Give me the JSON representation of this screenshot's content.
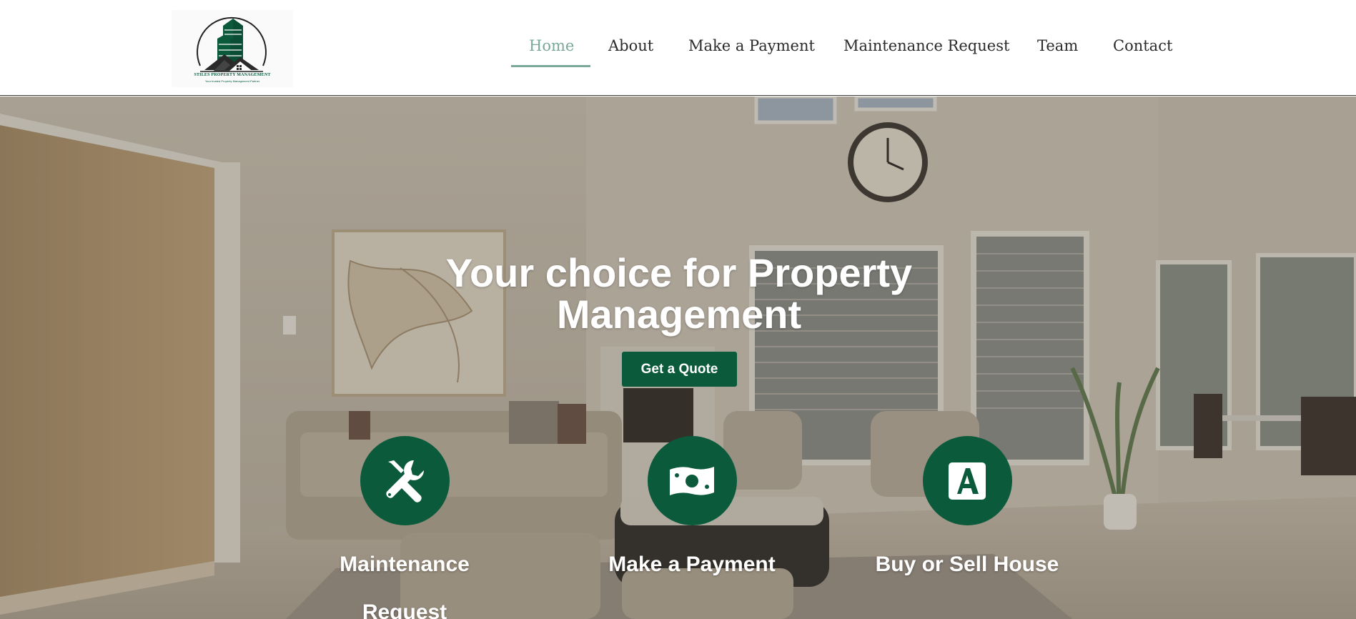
{
  "brand": {
    "logo_icon": "building-house-logo",
    "name": "STILES PROPERTY MANAGEMENT",
    "tagline": "Your trusted Property Management Partner",
    "accent_color": "#0b5a3c",
    "nav_active_color": "#7aa89a"
  },
  "nav": {
    "items": [
      {
        "label": "Home",
        "active": true
      },
      {
        "label": "About",
        "active": false
      },
      {
        "label": "Make a Payment",
        "active": false
      },
      {
        "label": "Maintenance Request",
        "active": false
      },
      {
        "label": "Team",
        "active": false
      },
      {
        "label": "Contact",
        "active": false
      }
    ]
  },
  "hero": {
    "title": "Your choice for Property Management",
    "cta_label": "Get a Quote",
    "background": "living-room-photo"
  },
  "services": [
    {
      "icon": "tools-icon",
      "label": "Maintenance Request"
    },
    {
      "icon": "money-bill-icon",
      "label": "Make a Payment"
    },
    {
      "icon": "broker-letter-a-icon",
      "label": "Buy or Sell House"
    }
  ]
}
